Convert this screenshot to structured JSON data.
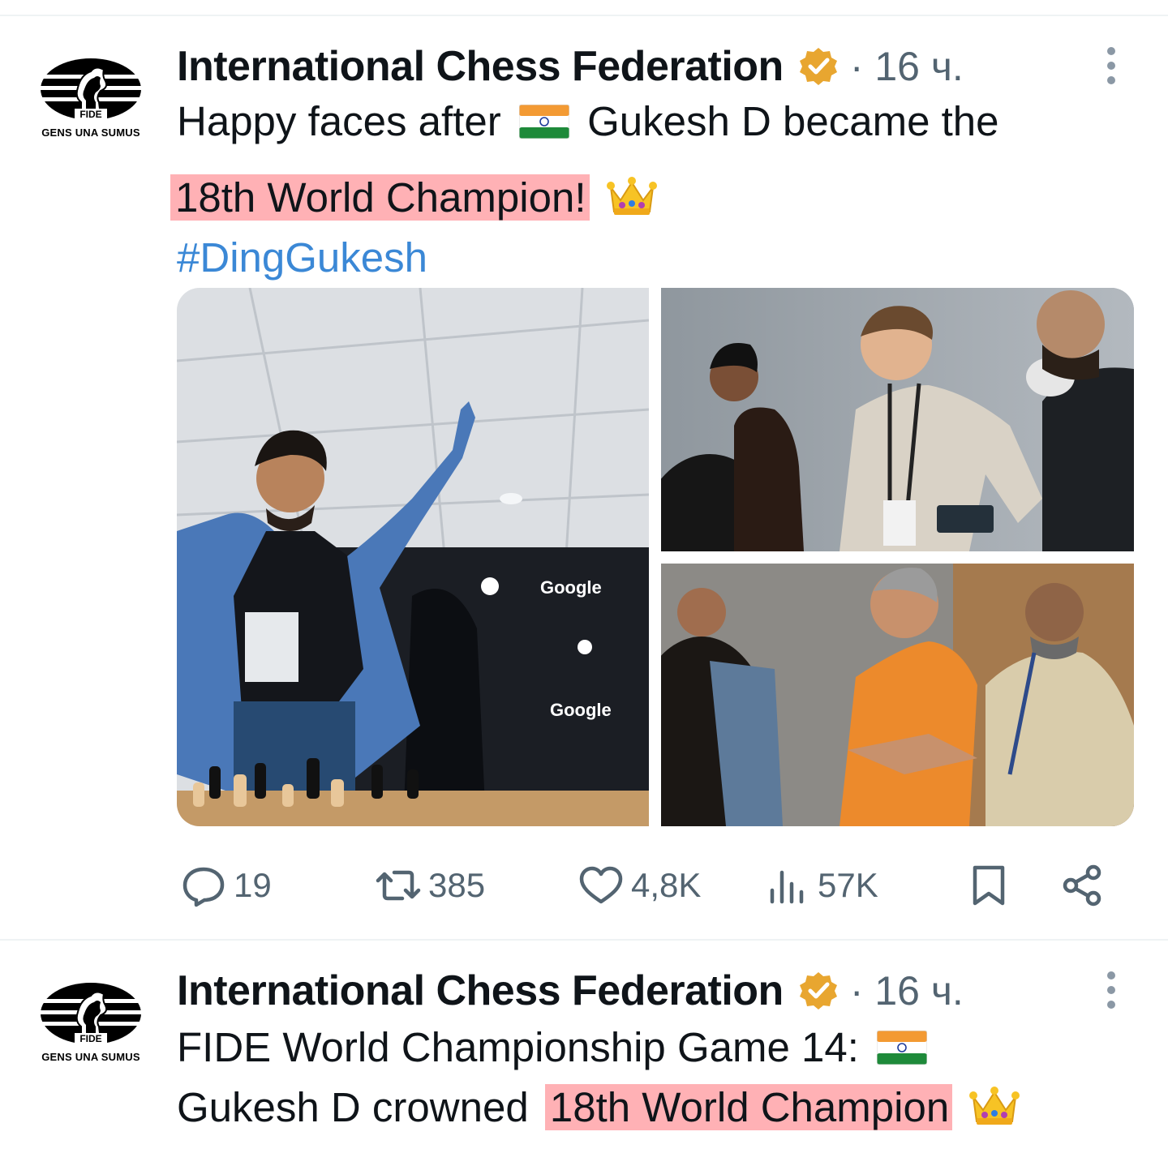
{
  "tweets": [
    {
      "author": {
        "name": "International Chess Federation",
        "verified_icon": "verified-badge-gold",
        "logo_text": "FIDE",
        "logo_motto": "GENS UNA SUMUS"
      },
      "time": "· 16 ч.",
      "text": {
        "line1_before_flag": "Happy faces after",
        "line1_after_flag": "Gukesh D became the",
        "line2_highlight": "18th World Champion!",
        "hashtag": "#DingGukesh"
      },
      "media_logos": {
        "sponsor1": "Google",
        "sponsor2": "Google"
      },
      "stats": {
        "replies": "19",
        "retweets": "385",
        "likes": "4,8K",
        "views": "57K"
      }
    },
    {
      "author": {
        "name": "International Chess Federation",
        "verified_icon": "verified-badge-gold",
        "logo_text": "FIDE",
        "logo_motto": "GENS UNA SUMUS"
      },
      "time": "· 16 ч.",
      "text": {
        "line1": "FIDE World Championship Game 14:",
        "line2_before": "Gukesh D crowned",
        "line2_highlight": "18th World Champion"
      }
    }
  ],
  "colors": {
    "highlight": "#ffb1b5",
    "hashtag": "#3b88d6",
    "muted": "#536471",
    "verified": "#e8a630"
  }
}
